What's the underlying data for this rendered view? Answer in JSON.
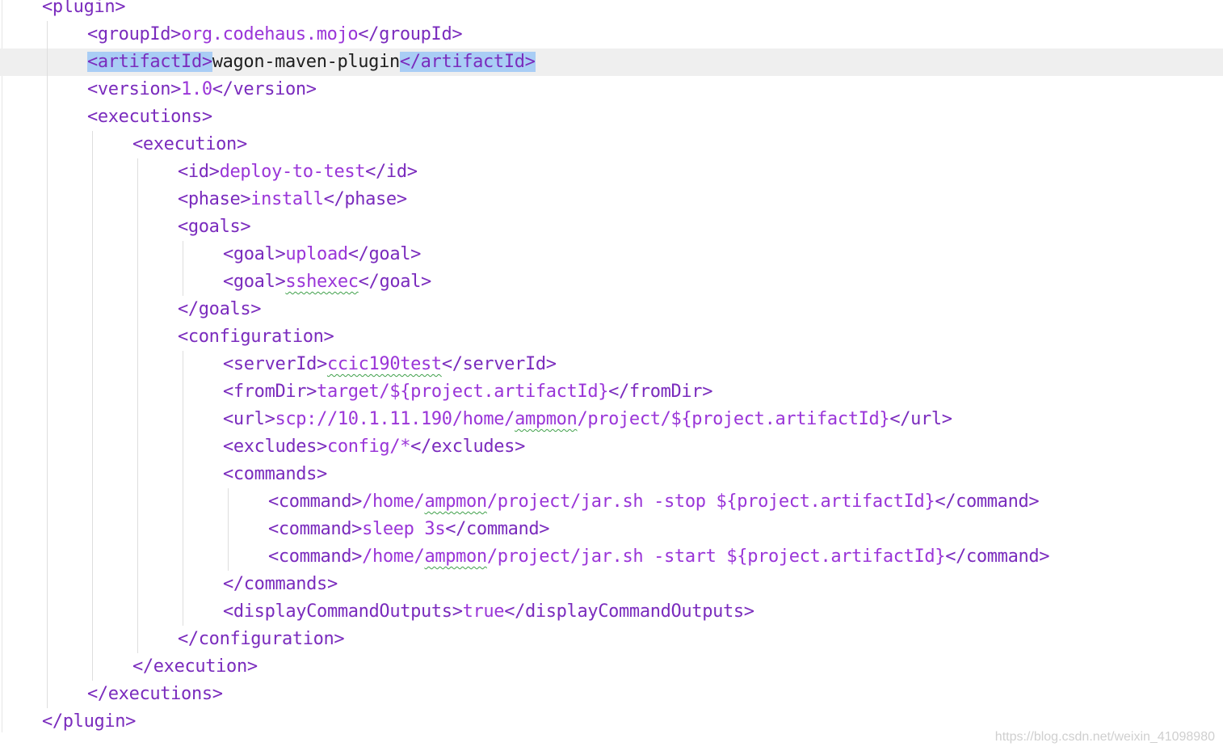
{
  "editor": {
    "language": "xml",
    "current_line": 2,
    "colors": {
      "tag": "#7a2bbd",
      "value": "#9a35d8",
      "plain": "#1e1e1e",
      "selection": "#a9cdf5",
      "current_line_bg": "#efefef",
      "squiggle": "#3fa04a"
    },
    "lines": [
      {
        "indent": 1,
        "tokens": [
          {
            "t": "<plugin>",
            "k": "tag"
          }
        ]
      },
      {
        "indent": 2,
        "tokens": [
          {
            "t": "<groupId>",
            "k": "tag"
          },
          {
            "t": "org.codehaus.mojo",
            "k": "val"
          },
          {
            "t": "</groupId>",
            "k": "tag"
          }
        ]
      },
      {
        "indent": 2,
        "tokens": [
          {
            "t": "<artifactId>",
            "k": "tag",
            "hl": true
          },
          {
            "t": "wagon-maven-plugin",
            "k": "plain"
          },
          {
            "t": "</artifactId>",
            "k": "tag",
            "hl": true
          }
        ]
      },
      {
        "indent": 2,
        "tokens": [
          {
            "t": "<version>",
            "k": "tag"
          },
          {
            "t": "1.0",
            "k": "val"
          },
          {
            "t": "</version>",
            "k": "tag"
          }
        ]
      },
      {
        "indent": 2,
        "tokens": [
          {
            "t": "<executions>",
            "k": "tag"
          }
        ]
      },
      {
        "indent": 3,
        "tokens": [
          {
            "t": "<execution>",
            "k": "tag"
          }
        ]
      },
      {
        "indent": 4,
        "tokens": [
          {
            "t": "<id>",
            "k": "tag"
          },
          {
            "t": "deploy-to-test",
            "k": "val"
          },
          {
            "t": "</id>",
            "k": "tag"
          }
        ]
      },
      {
        "indent": 4,
        "tokens": [
          {
            "t": "<phase>",
            "k": "tag"
          },
          {
            "t": "install",
            "k": "val"
          },
          {
            "t": "</phase>",
            "k": "tag"
          }
        ]
      },
      {
        "indent": 4,
        "tokens": [
          {
            "t": "<goals>",
            "k": "tag"
          }
        ]
      },
      {
        "indent": 5,
        "tokens": [
          {
            "t": "<goal>",
            "k": "tag"
          },
          {
            "t": "upload",
            "k": "val"
          },
          {
            "t": "</goal>",
            "k": "tag"
          }
        ]
      },
      {
        "indent": 5,
        "tokens": [
          {
            "t": "<goal>",
            "k": "tag"
          },
          {
            "t": "sshexec",
            "k": "val",
            "sq": true
          },
          {
            "t": "</goal>",
            "k": "tag"
          }
        ]
      },
      {
        "indent": 4,
        "tokens": [
          {
            "t": "</goals>",
            "k": "tag"
          }
        ]
      },
      {
        "indent": 4,
        "tokens": [
          {
            "t": "<configuration>",
            "k": "tag"
          }
        ]
      },
      {
        "indent": 5,
        "tokens": [
          {
            "t": "<serverId>",
            "k": "tag"
          },
          {
            "t": "ccic190test",
            "k": "val",
            "sq": true
          },
          {
            "t": "</serverId>",
            "k": "tag"
          }
        ]
      },
      {
        "indent": 5,
        "tokens": [
          {
            "t": "<fromDir>",
            "k": "tag"
          },
          {
            "t": "target/${project.artifactId}",
            "k": "val"
          },
          {
            "t": "</fromDir>",
            "k": "tag"
          }
        ]
      },
      {
        "indent": 5,
        "tokens": [
          {
            "t": "<url>",
            "k": "tag"
          },
          {
            "t": "scp://10.1.11.190/home/",
            "k": "val"
          },
          {
            "t": "ampmon",
            "k": "val",
            "sq": true
          },
          {
            "t": "/project/${project.artifactId}",
            "k": "val"
          },
          {
            "t": "</url>",
            "k": "tag"
          }
        ]
      },
      {
        "indent": 5,
        "tokens": [
          {
            "t": "<excludes>",
            "k": "tag"
          },
          {
            "t": "config/*",
            "k": "val"
          },
          {
            "t": "</excludes>",
            "k": "tag"
          }
        ]
      },
      {
        "indent": 5,
        "tokens": [
          {
            "t": "<commands>",
            "k": "tag"
          }
        ]
      },
      {
        "indent": 6,
        "tokens": [
          {
            "t": "<command>",
            "k": "tag"
          },
          {
            "t": "/home/",
            "k": "val"
          },
          {
            "t": "ampmon",
            "k": "val",
            "sq": true
          },
          {
            "t": "/project/jar.sh -stop ${project.artifactId}",
            "k": "val"
          },
          {
            "t": "</command>",
            "k": "tag"
          }
        ]
      },
      {
        "indent": 6,
        "tokens": [
          {
            "t": "<command>",
            "k": "tag"
          },
          {
            "t": "sleep 3s",
            "k": "val"
          },
          {
            "t": "</command>",
            "k": "tag"
          }
        ]
      },
      {
        "indent": 6,
        "tokens": [
          {
            "t": "<command>",
            "k": "tag"
          },
          {
            "t": "/home/",
            "k": "val"
          },
          {
            "t": "ampmon",
            "k": "val",
            "sq": true
          },
          {
            "t": "/project/jar.sh -start ${project.artifactId}",
            "k": "val"
          },
          {
            "t": "</command>",
            "k": "tag"
          }
        ]
      },
      {
        "indent": 5,
        "tokens": [
          {
            "t": "</commands>",
            "k": "tag"
          }
        ]
      },
      {
        "indent": 5,
        "tokens": [
          {
            "t": "<displayCommandOutputs>",
            "k": "tag"
          },
          {
            "t": "true",
            "k": "val"
          },
          {
            "t": "</displayCommandOutputs>",
            "k": "tag"
          }
        ]
      },
      {
        "indent": 4,
        "tokens": [
          {
            "t": "</configuration>",
            "k": "tag"
          }
        ]
      },
      {
        "indent": 3,
        "tokens": [
          {
            "t": "</execution>",
            "k": "tag"
          }
        ]
      },
      {
        "indent": 2,
        "tokens": [
          {
            "t": "</executions>",
            "k": "tag"
          }
        ]
      },
      {
        "indent": 1,
        "tokens": [
          {
            "t": "</plugin>",
            "k": "tag"
          }
        ]
      }
    ]
  },
  "watermark": "https://blog.csdn.net/weixin_41098980"
}
